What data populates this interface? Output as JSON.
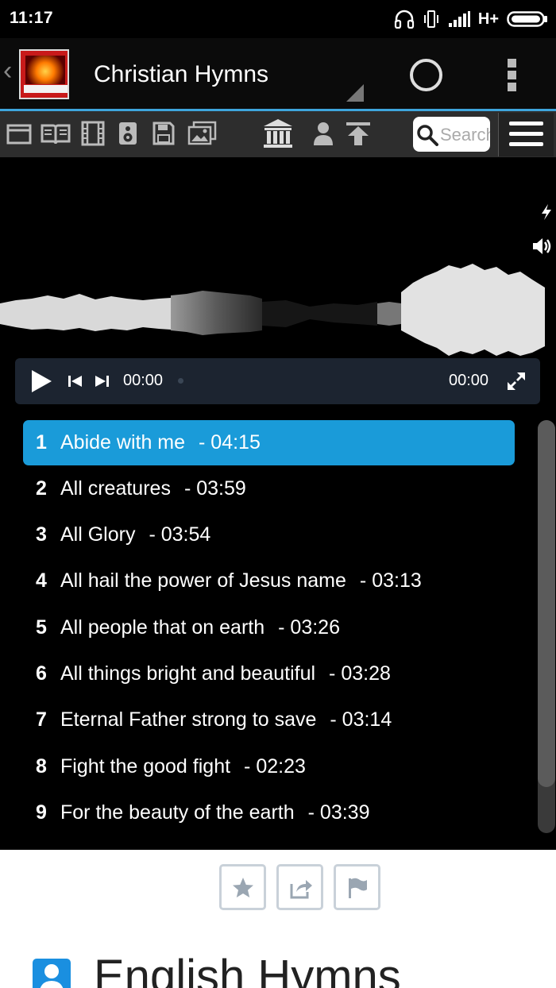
{
  "status": {
    "time": "11:17",
    "network": "H+"
  },
  "app_bar": {
    "title": "Christian Hymns",
    "logo_alt": "Christian Hymns & Sermons"
  },
  "toolbar": {
    "search_placeholder": "Search"
  },
  "player": {
    "current_time": "00:00",
    "total_time": "00:00"
  },
  "playlist": [
    {
      "num": "1",
      "title": "Abide with me",
      "duration": "- 04:15",
      "active": true
    },
    {
      "num": "2",
      "title": "All creatures",
      "duration": "- 03:59"
    },
    {
      "num": "3",
      "title": "All Glory",
      "duration": "- 03:54"
    },
    {
      "num": "4",
      "title": "All hail the power of Jesus name",
      "duration": "- 03:13"
    },
    {
      "num": "5",
      "title": "All people that on earth",
      "duration": "- 03:26"
    },
    {
      "num": "6",
      "title": "All things bright and beautiful",
      "duration": "- 03:28"
    },
    {
      "num": "7",
      "title": "Eternal Father strong to save",
      "duration": "- 03:14"
    },
    {
      "num": "8",
      "title": "Fight the good fight",
      "duration": "- 02:23"
    },
    {
      "num": "9",
      "title": "For the beauty of the earth",
      "duration": "- 03:39"
    }
  ],
  "section": {
    "title": "English Hymns"
  },
  "colors": {
    "accent": "#1a9bd9",
    "app_bar_line": "#3ea6dd",
    "toolbar_bg": "#2d2d2d",
    "player_bar_bg": "#1c2430"
  },
  "icons": [
    "headphones-icon",
    "vibrate-icon",
    "signal-icon",
    "battery-icon",
    "window-icon",
    "book-icon",
    "film-icon",
    "speaker-icon",
    "save-icon",
    "images-icon",
    "library-icon",
    "user-icon",
    "upload-icon",
    "search-icon",
    "menu-icon",
    "flash-icon",
    "volume-icon",
    "play-icon",
    "previous-icon",
    "next-icon",
    "fullscreen-icon",
    "star-icon",
    "share-icon",
    "flag-icon",
    "person-icon"
  ]
}
